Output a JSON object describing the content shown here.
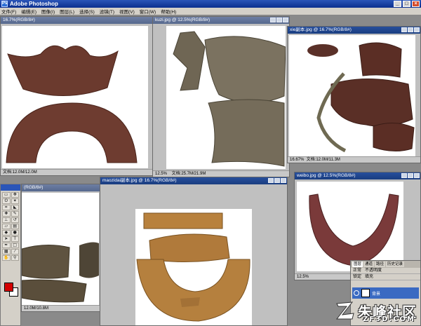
{
  "app": {
    "title": "Adobe Photoshop"
  },
  "menu": [
    "文件(F)",
    "编辑(E)",
    "图像(I)",
    "图层(L)",
    "选择(S)",
    "滤镜(T)",
    "视图(V)",
    "窗口(W)",
    "帮助(H)"
  ],
  "documents": {
    "doc1": {
      "title": "16.7%(RGB/8#)",
      "zoom": "",
      "size": "文档:12.0M/12.0M"
    },
    "doc2": {
      "title": "kuzi.jpg @ 12.5%(RGB/8#)",
      "zoom": "12.5%",
      "size": "文档:25.7M/21.9M"
    },
    "doc3": {
      "title": "xie副本.jpg @ 16.7%(RGB/8#)",
      "zoom": "16.67%",
      "size": "文档:12.0M/11.3M"
    },
    "doc4": {
      "title": "(RGB/8#)",
      "zoom": "",
      "size": "12.0M/10.8M"
    },
    "doc5": {
      "title": "maozidai副本.jpg @ 16.7%(RGB/8#)",
      "zoom": "",
      "size": ""
    },
    "doc6": {
      "title": "weibo.jpg @ 12.5%(RGB/8#)",
      "zoom": "12.5%",
      "size": ""
    }
  },
  "layers_panel": {
    "tabs": [
      "图层",
      "通道",
      "路径",
      "历史记录"
    ],
    "blend_mode": "正常",
    "opacity_label": "不透明度",
    "lock_label": "锁定",
    "fill_label": "填充",
    "layer_name": "背景"
  },
  "colors": {
    "foreground": "#d40000",
    "background": "#ffffff"
  },
  "watermark": {
    "text": "朱峰社区",
    "sub": "ZF3D.COM"
  }
}
